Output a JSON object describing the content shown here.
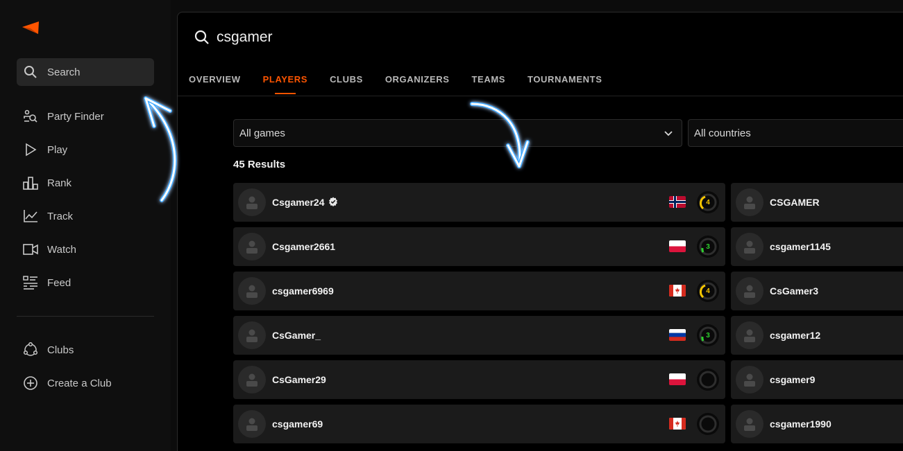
{
  "sidebar": {
    "search_label": "Search",
    "items": [
      {
        "label": "Party Finder",
        "icon": "party-finder-icon"
      },
      {
        "label": "Play",
        "icon": "play-icon"
      },
      {
        "label": "Rank",
        "icon": "rank-icon"
      },
      {
        "label": "Track",
        "icon": "track-icon"
      },
      {
        "label": "Watch",
        "icon": "watch-icon"
      },
      {
        "label": "Feed",
        "icon": "feed-icon"
      }
    ],
    "clubs": [
      {
        "label": "Clubs",
        "icon": "clubs-icon"
      },
      {
        "label": "Create a Club",
        "icon": "plus-circle-icon"
      }
    ]
  },
  "search": {
    "query": "csgamer"
  },
  "tabs": [
    {
      "label": "OVERVIEW",
      "active": false
    },
    {
      "label": "PLAYERS",
      "active": true
    },
    {
      "label": "CLUBS",
      "active": false
    },
    {
      "label": "ORGANIZERS",
      "active": false
    },
    {
      "label": "TEAMS",
      "active": false
    },
    {
      "label": "TOURNAMENTS",
      "active": false
    }
  ],
  "filters": {
    "game": "All games",
    "country": "All countries"
  },
  "results_count": "45 Results",
  "colors": {
    "accent": "#ff5500",
    "level_4": "#f7c600",
    "level_3": "#2fd12f"
  },
  "players_left": [
    {
      "name": "Csgamer24",
      "verified": true,
      "flag": "norway",
      "level": "4"
    },
    {
      "name": "Csgamer2661",
      "verified": false,
      "flag": "poland",
      "level": "3"
    },
    {
      "name": "csgamer6969",
      "verified": false,
      "flag": "canada",
      "level": "4"
    },
    {
      "name": "CsGamer_",
      "verified": false,
      "flag": "russia",
      "level": "3"
    },
    {
      "name": "CsGamer29",
      "verified": false,
      "flag": "poland",
      "level": ""
    },
    {
      "name": "csgamer69",
      "verified": false,
      "flag": "canada",
      "level": ""
    }
  ],
  "players_right": [
    {
      "name": "CSGAMER"
    },
    {
      "name": "csgamer1145"
    },
    {
      "name": "CsGamer3"
    },
    {
      "name": "csgamer12"
    },
    {
      "name": "csgamer9"
    },
    {
      "name": "csgamer1990"
    }
  ]
}
